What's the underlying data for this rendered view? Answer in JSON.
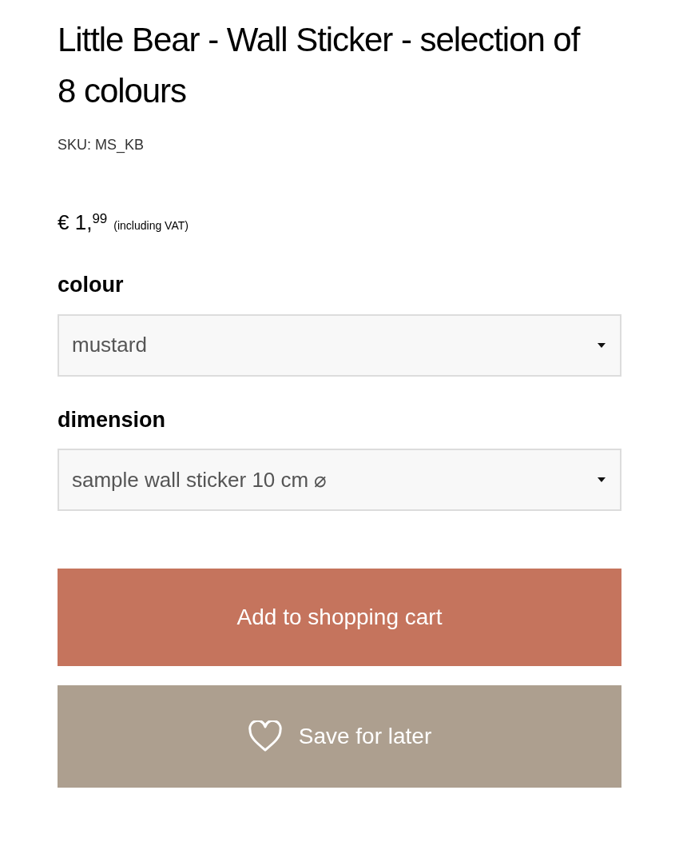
{
  "product": {
    "title": "Little Bear - Wall Sticker - selection of 8 colours",
    "sku": "SKU: MS_KB",
    "price": "€ 1,$^{99}$",
    "price_note": "(including VAT)"
  },
  "options": [
    {
      "label": "colour",
      "value": "mustard"
    },
    {
      "label": "dimension",
      "value": "sample wall sticker 10 cm ⌀"
    }
  ],
  "buttons": [
    {
      "kind": "cart",
      "label": "Add to shopping cart"
    },
    {
      "kind": "wishlist",
      "label": "Save for later"
    }
  ]
}
